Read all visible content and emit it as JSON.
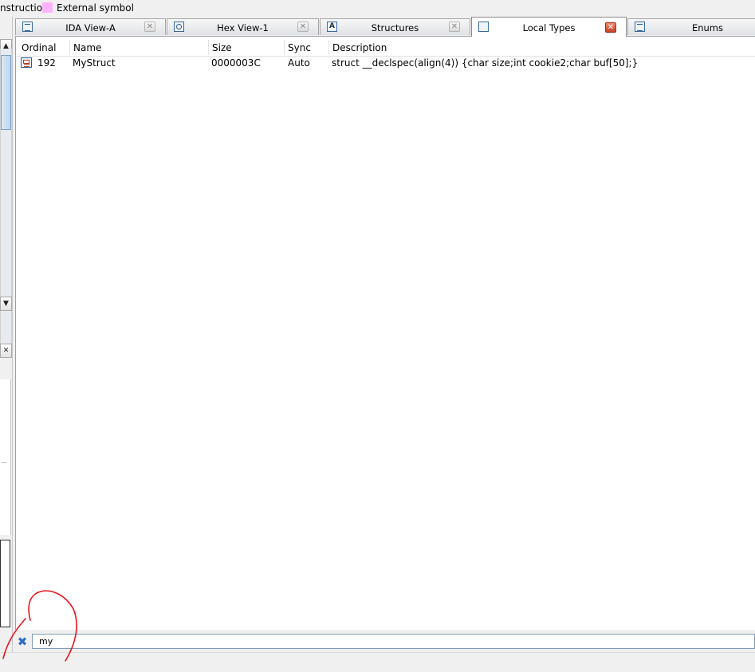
{
  "legend": {
    "instruction_label": "nstruction",
    "external_label": "External symbol",
    "external_color": "#ffb3ff"
  },
  "tabs": [
    {
      "label": "IDA View-A",
      "icon": "ida-view-icon",
      "active": false
    },
    {
      "label": "Hex View-1",
      "icon": "hex-view-icon",
      "active": false
    },
    {
      "label": "Structures",
      "icon": "structures-icon",
      "active": false
    },
    {
      "label": "Local Types",
      "icon": "local-types-icon",
      "active": true
    },
    {
      "label": "Enums",
      "icon": "enums-icon",
      "active": false
    }
  ],
  "table": {
    "columns": [
      "Ordinal",
      "Name",
      "Size",
      "Sync",
      "Description"
    ],
    "rows": [
      {
        "ordinal": "192",
        "name": "MyStruct",
        "size": "0000003C",
        "sync": "Auto",
        "description": "struct __declspec(align(4)) {char size;int cookie2;char buf[50];}"
      }
    ]
  },
  "filter": {
    "value": "my"
  },
  "colors": {
    "active_close": "#c8412a",
    "selection_blue": "#3a6aa0",
    "annotation_red": "#e8141e"
  }
}
